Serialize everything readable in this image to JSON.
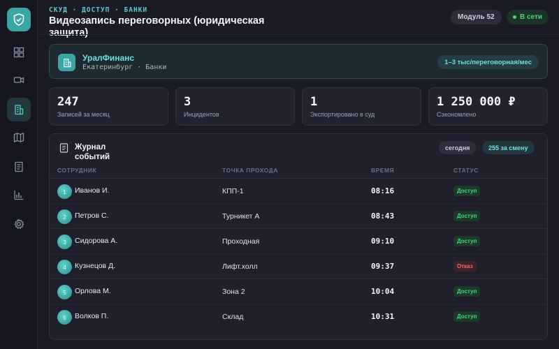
{
  "sidebar": {
    "items": [
      {
        "name": "dashboard",
        "icon": "dashboard-icon",
        "active": false
      },
      {
        "name": "cameras",
        "icon": "camera-icon",
        "active": false
      },
      {
        "name": "buildings",
        "icon": "building-icon",
        "active": true
      },
      {
        "name": "map",
        "icon": "map-icon",
        "active": false
      },
      {
        "name": "documents",
        "icon": "document-icon",
        "active": false
      },
      {
        "name": "reports",
        "icon": "chart-icon",
        "active": false
      },
      {
        "name": "settings",
        "icon": "gear-icon",
        "active": false
      }
    ]
  },
  "header": {
    "breadcrumb": "СКУД · ДОСТУП · БАНКИ",
    "title": "Видеозапись переговорных (юридическая защита)",
    "module_label": "Модуль 52",
    "status_label": "В сети"
  },
  "company": {
    "name": "УралФинанс",
    "city": "Екатеринбург",
    "sector": "Банки",
    "rate": "1–3 тыс/переговорная/мес"
  },
  "stats": [
    {
      "value": "247",
      "label": "Записей за месяц"
    },
    {
      "value": "3",
      "label": "Инцидентов"
    },
    {
      "value": "1",
      "label": "Экспортировано в суд"
    },
    {
      "value": "1 250 000 ₽",
      "label": "Сэкономлено"
    }
  ],
  "log": {
    "title": "Журнал событий",
    "today_label": "сегодня",
    "shift_label": "255 за смену",
    "columns": {
      "employee": "СОТРУДНИК",
      "point": "ТОЧКА ПРОХОДА",
      "time": "ВРЕМЯ",
      "status": "СТАТУС"
    },
    "rows": [
      {
        "num": "1",
        "name": "Иванов И.",
        "point": "КПП-1",
        "time": "08:16",
        "status": "Доступ",
        "ok": true
      },
      {
        "num": "2",
        "name": "Петров С.",
        "point": "Турникет А",
        "time": "08:43",
        "status": "Доступ",
        "ok": true
      },
      {
        "num": "3",
        "name": "Сидорова А.",
        "point": "Проходная",
        "time": "09:10",
        "status": "Доступ",
        "ok": true
      },
      {
        "num": "4",
        "name": "Кузнецов Д.",
        "point": "Лифт.холл",
        "time": "09:37",
        "status": "Отказ",
        "ok": false
      },
      {
        "num": "5",
        "name": "Орлова М.",
        "point": "Зона 2",
        "time": "10:04",
        "status": "Доступ",
        "ok": true
      },
      {
        "num": "6",
        "name": "Волков П.",
        "point": "Склад",
        "time": "10:31",
        "status": "Доступ",
        "ok": true
      }
    ]
  },
  "colors": {
    "accent": "#3aa6a4",
    "ok": "#4bd07f",
    "deny": "#ef6b6b"
  }
}
